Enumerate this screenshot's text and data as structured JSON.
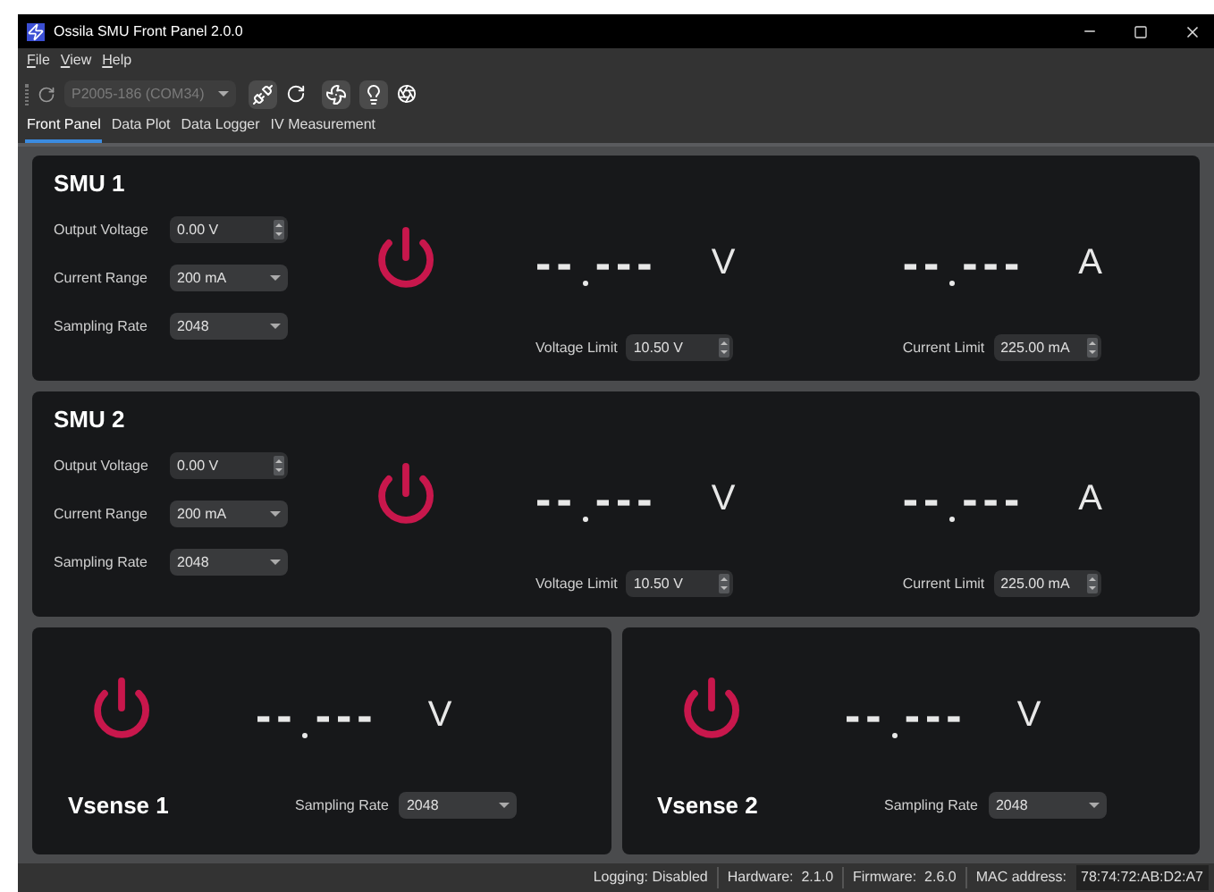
{
  "window": {
    "title": "Ossila SMU Front Panel 2.0.0"
  },
  "menu": [
    "File",
    "View",
    "Help"
  ],
  "toolbar": {
    "port": {
      "value": "P2005-186 (COM34)",
      "disabled": true
    }
  },
  "tabs": [
    {
      "label": "Front Panel",
      "selected": true
    },
    {
      "label": "Data Plot",
      "selected": false
    },
    {
      "label": "Data Logger",
      "selected": false
    },
    {
      "label": "IV Measurement",
      "selected": false
    }
  ],
  "smus": [
    {
      "title": "SMU 1",
      "output_voltage": {
        "label": "Output Voltage",
        "value": "0.00 V"
      },
      "current_range": {
        "label": "Current Range",
        "value": "200 mA"
      },
      "sampling_rate": {
        "label": "Sampling Rate",
        "value": "2048"
      },
      "voltage_readout": {
        "whole": "--",
        "fraction": "---",
        "unit": "V"
      },
      "current_readout": {
        "whole": "--",
        "fraction": "---",
        "unit": "A"
      },
      "voltage_limit": {
        "label": "Voltage Limit",
        "value": "10.50 V"
      },
      "current_limit": {
        "label": "Current Limit",
        "value": "225.00 mA"
      }
    },
    {
      "title": "SMU 2",
      "output_voltage": {
        "label": "Output Voltage",
        "value": "0.00 V"
      },
      "current_range": {
        "label": "Current Range",
        "value": "200 mA"
      },
      "sampling_rate": {
        "label": "Sampling Rate",
        "value": "2048"
      },
      "voltage_readout": {
        "whole": "--",
        "fraction": "---",
        "unit": "V"
      },
      "current_readout": {
        "whole": "--",
        "fraction": "---",
        "unit": "A"
      },
      "voltage_limit": {
        "label": "Voltage Limit",
        "value": "10.50 V"
      },
      "current_limit": {
        "label": "Current Limit",
        "value": "225.00 mA"
      }
    }
  ],
  "vsense": [
    {
      "title": "Vsense 1",
      "readout": {
        "whole": "--",
        "fraction": "---",
        "unit": "V"
      },
      "sampling_rate": {
        "label": "Sampling Rate",
        "value": "2048"
      }
    },
    {
      "title": "Vsense 2",
      "readout": {
        "whole": "--",
        "fraction": "---",
        "unit": "V"
      },
      "sampling_rate": {
        "label": "Sampling Rate",
        "value": "2048"
      }
    }
  ],
  "status_bar": {
    "logging": "Logging: Disabled",
    "hardware": "Hardware:  2.1.0",
    "firmware": "Firmware:  2.6.0",
    "mac_label": "MAC address:",
    "mac_value": "78:74:72:AB:D2:A7"
  }
}
